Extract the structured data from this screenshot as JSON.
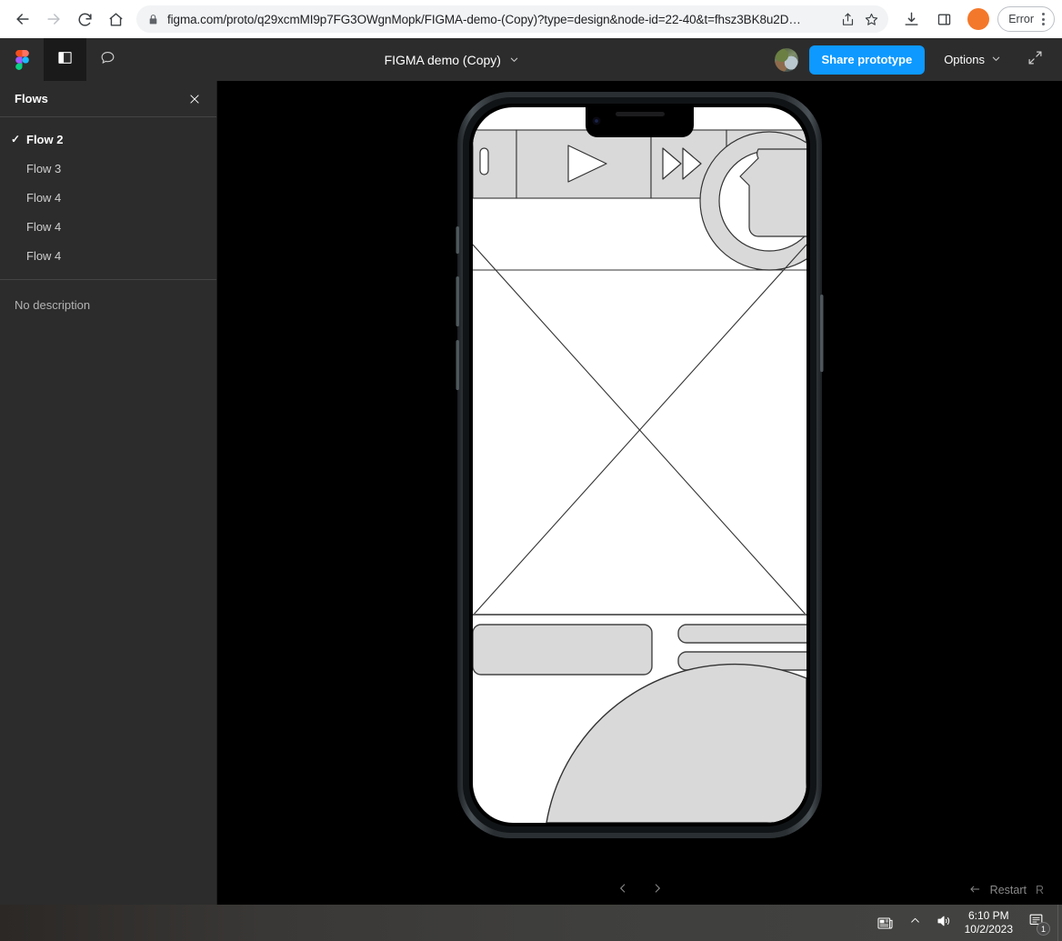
{
  "browser": {
    "back_label": "Back",
    "forward_label": "Forward",
    "reload_label": "Reload",
    "home_label": "Home",
    "url": "figma.com/proto/q29xcmMI9p7FG3OWgnMopk/FIGMA-demo-(Copy)?type=design&node-id=22-40&t=fhsz3BK8u2D…",
    "lock_icon": "lock-icon",
    "share_icon": "share-icon",
    "bookmark_icon": "star-icon",
    "download_icon": "download-icon",
    "sidepanel_icon": "side-panel-icon",
    "profile_icon": "profile-avatar",
    "profile_color": "#f4782b",
    "error_label": "Error",
    "menu_icon": "three-dot-menu-icon"
  },
  "figma": {
    "logo": "figma-logo",
    "sidebar_toggle_icon": "left-panel-icon",
    "comment_icon": "comment-bubble-icon",
    "title": "FIGMA demo (Copy)",
    "title_chevron": "chevron-down-icon",
    "avatar": "user-avatar-photo",
    "share_label": "Share prototype",
    "accent_color": "#0d99ff",
    "options_label": "Options",
    "options_chevron": "chevron-down-icon",
    "fullscreen_icon": "fullscreen-icon"
  },
  "flows_panel": {
    "title": "Flows",
    "close_icon": "close-icon",
    "check_icon": "✓",
    "items": [
      {
        "label": "Flow 2",
        "selected": true
      },
      {
        "label": "Flow 3",
        "selected": false
      },
      {
        "label": "Flow 4",
        "selected": false
      },
      {
        "label": "Flow 4",
        "selected": false
      },
      {
        "label": "Flow 4",
        "selected": false
      }
    ],
    "description": "No description"
  },
  "prototype": {
    "device": "iPhone frame",
    "prev_icon": "chevron-left-icon",
    "next_icon": "chevron-right-icon",
    "restart_icon": "restart-arrow-icon",
    "restart_label": "Restart",
    "restart_shortcut": "R"
  },
  "taskbar": {
    "news_icon": "news-and-interests-icon",
    "show_hidden_icon": "chevron-up-icon",
    "volume_icon": "speaker-icon",
    "time": "6:10 PM",
    "date": "10/2/2023",
    "notifications_icon": "notifications-icon",
    "notifications_count": "1"
  }
}
